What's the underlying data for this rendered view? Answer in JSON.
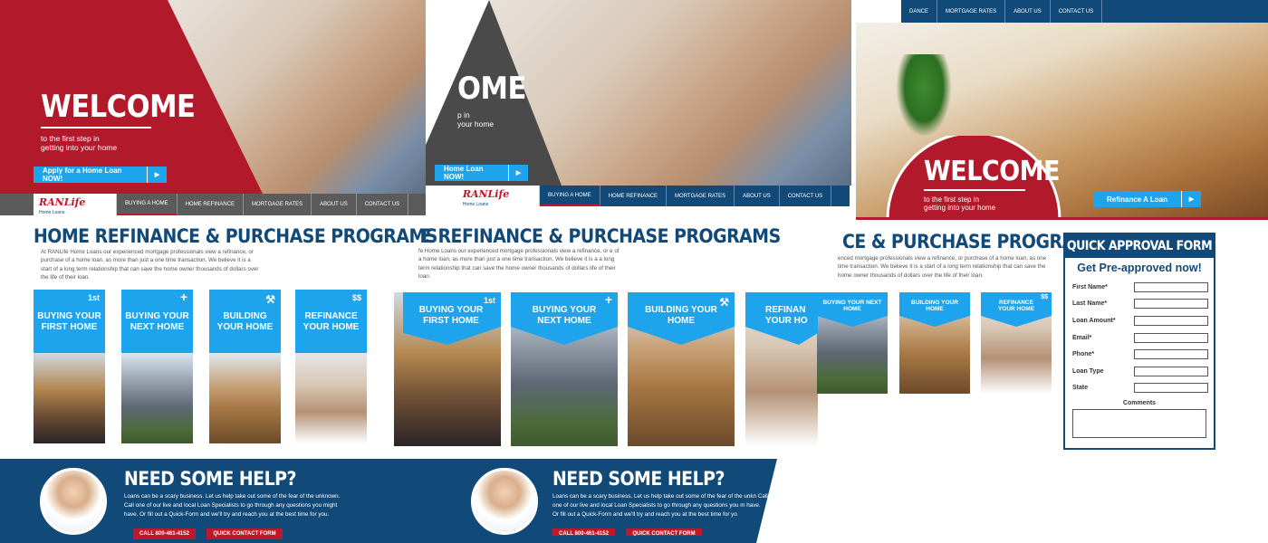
{
  "nav": {
    "logo": "RANLife",
    "logo_sub": "Home Loans",
    "items": [
      "BUYING A HOME",
      "HOME REFINANCE",
      "MORTGAGE RATES",
      "ABOUT US",
      "CONTACT US"
    ],
    "top_items": [
      "DANCE",
      "MORTGAGE RATES",
      "ABOUT US",
      "CONTACT US"
    ]
  },
  "hero": {
    "title": "WELCOME",
    "tagline_1": "to the first step in",
    "tagline_2": "getting into your home",
    "apply_button": "Apply for a Home Loan NOW!",
    "partial_title": "OME",
    "partial_tag_1": "p in",
    "partial_tag_2": "your home",
    "partial_button": "Home Loan NOW!",
    "refinance_button": "Refinance A Loan"
  },
  "programs": {
    "title": "HOME REFINANCE & PURCHASE PROGRAMS",
    "title_partial_2": "E REFINANCE & PURCHASE PROGRAMS",
    "title_partial_3": "CE & PURCHASE PROGRAMS",
    "intro": "At RANLife Home Loans our experienced mortgage professionals view a refinance, or purchase of a home loan, as more than just a one time transaction. We believe it is a start of a long term relationship that can save the home owner thousands of dollars over the life of their loan.",
    "intro_2": "fe Home Loans our experienced mortgage professionals view a refinance, or e of a home loan, as more than just a one time transaction. We believe it is a a long term relationship that can save the home owner thousands of dollars life of their loan.",
    "intro_3": "enced mortgage professionals view a refinance, or purchase of a home loan, as one time transaction. We believe it is a start of a long term relationship that can save the home owner thousands of dollars over the life of their loan.",
    "cards": [
      {
        "label": "BUYING YOUR FIRST HOME",
        "icon": "1st",
        "icon_name": "first-badge"
      },
      {
        "label": "BUYING YOUR NEXT HOME",
        "icon": "+",
        "icon_name": "plus-icon"
      },
      {
        "label": "BUILDING YOUR HOME",
        "icon": "⚒",
        "icon_name": "tools-icon"
      },
      {
        "label": "REFINANCE YOUR HOME",
        "icon": "$$",
        "icon_name": "dollar-icon"
      }
    ],
    "card_partial_4": "REFINAN YOUR HO"
  },
  "help": {
    "title": "NEED SOME HELP?",
    "text": "Loans can be a scary business. Let us help take out some of the fear of the unknown. Call one of our live and local Loan Specialists to go through any questions you might have. Or fill out a Quick-Form and we'll try and reach you at the best time for you.",
    "text_2": "Loans can be a scary business. Let us help take out some of the fear of the unkn Call one of our live and local Loan Specialists to go through any questions you m have. Or fill out a Quick-Form and we'll try and reach you at the best time for yo",
    "call_button": "CALL 800-461-4152",
    "contact_button": "QUICK CONTACT FORM"
  },
  "form": {
    "title": "QUICK APPROVAL FORM",
    "subtitle": "Get Pre-approved now!",
    "fields": [
      "First Name*",
      "Last Name*",
      "Loan Amount*",
      "Email*",
      "Phone*",
      "Loan Type",
      "State"
    ],
    "comments_label": "Comments"
  },
  "colors": {
    "navy": "#114a78",
    "red": "#c0182b",
    "sky": "#1ea4ec"
  }
}
